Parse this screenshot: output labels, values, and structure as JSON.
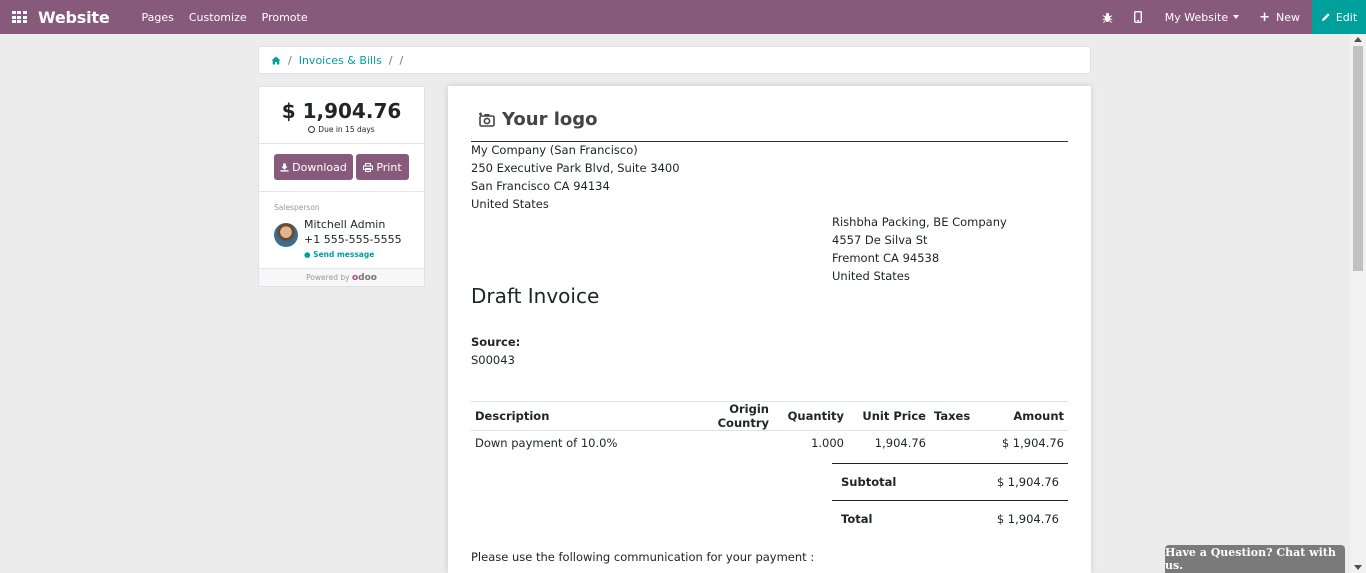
{
  "navbar": {
    "brand": "Website",
    "links": [
      "Pages",
      "Customize",
      "Promote"
    ],
    "website_selector": "My Website",
    "new_label": "New",
    "edit_label": "Edit"
  },
  "breadcrumb": {
    "link": "Invoices & Bills",
    "sep": "/"
  },
  "sidebar": {
    "amount": "$ 1,904.76",
    "due": "Due in 15 days",
    "download_label": "Download",
    "print_label": "Print",
    "salesperson_label": "Salesperson",
    "salesperson_name": "Mitchell Admin",
    "salesperson_phone": "+1 555-555-5555",
    "send_message": "Send message",
    "powered_by": "Powered by",
    "odoo": "odoo"
  },
  "invoice": {
    "logo_text": "Your logo",
    "company": [
      "My Company (San Francisco)",
      "250 Executive Park Blvd, Suite 3400",
      "San Francisco CA 94134",
      "United States"
    ],
    "customer": [
      "Rishbha Packing, BE Company",
      "4557 De Silva St",
      "Fremont CA 94538",
      "United States"
    ],
    "title": "Draft Invoice",
    "source_label": "Source:",
    "source_value": "S00043",
    "columns": [
      "Description",
      "Origin Country",
      "Quantity",
      "Unit Price",
      "Taxes",
      "Amount"
    ],
    "rows": [
      {
        "description": "Down payment of 10.0%",
        "origin": "",
        "quantity": "1.000",
        "unit_price": "1,904.76",
        "taxes": "",
        "amount": "$ 1,904.76"
      }
    ],
    "subtotal_label": "Subtotal",
    "subtotal_value": "$ 1,904.76",
    "total_label": "Total",
    "total_value": "$ 1,904.76",
    "communication": "Please use the following communication for your payment :"
  },
  "chat": {
    "label": "Have a Question? Chat with us."
  }
}
